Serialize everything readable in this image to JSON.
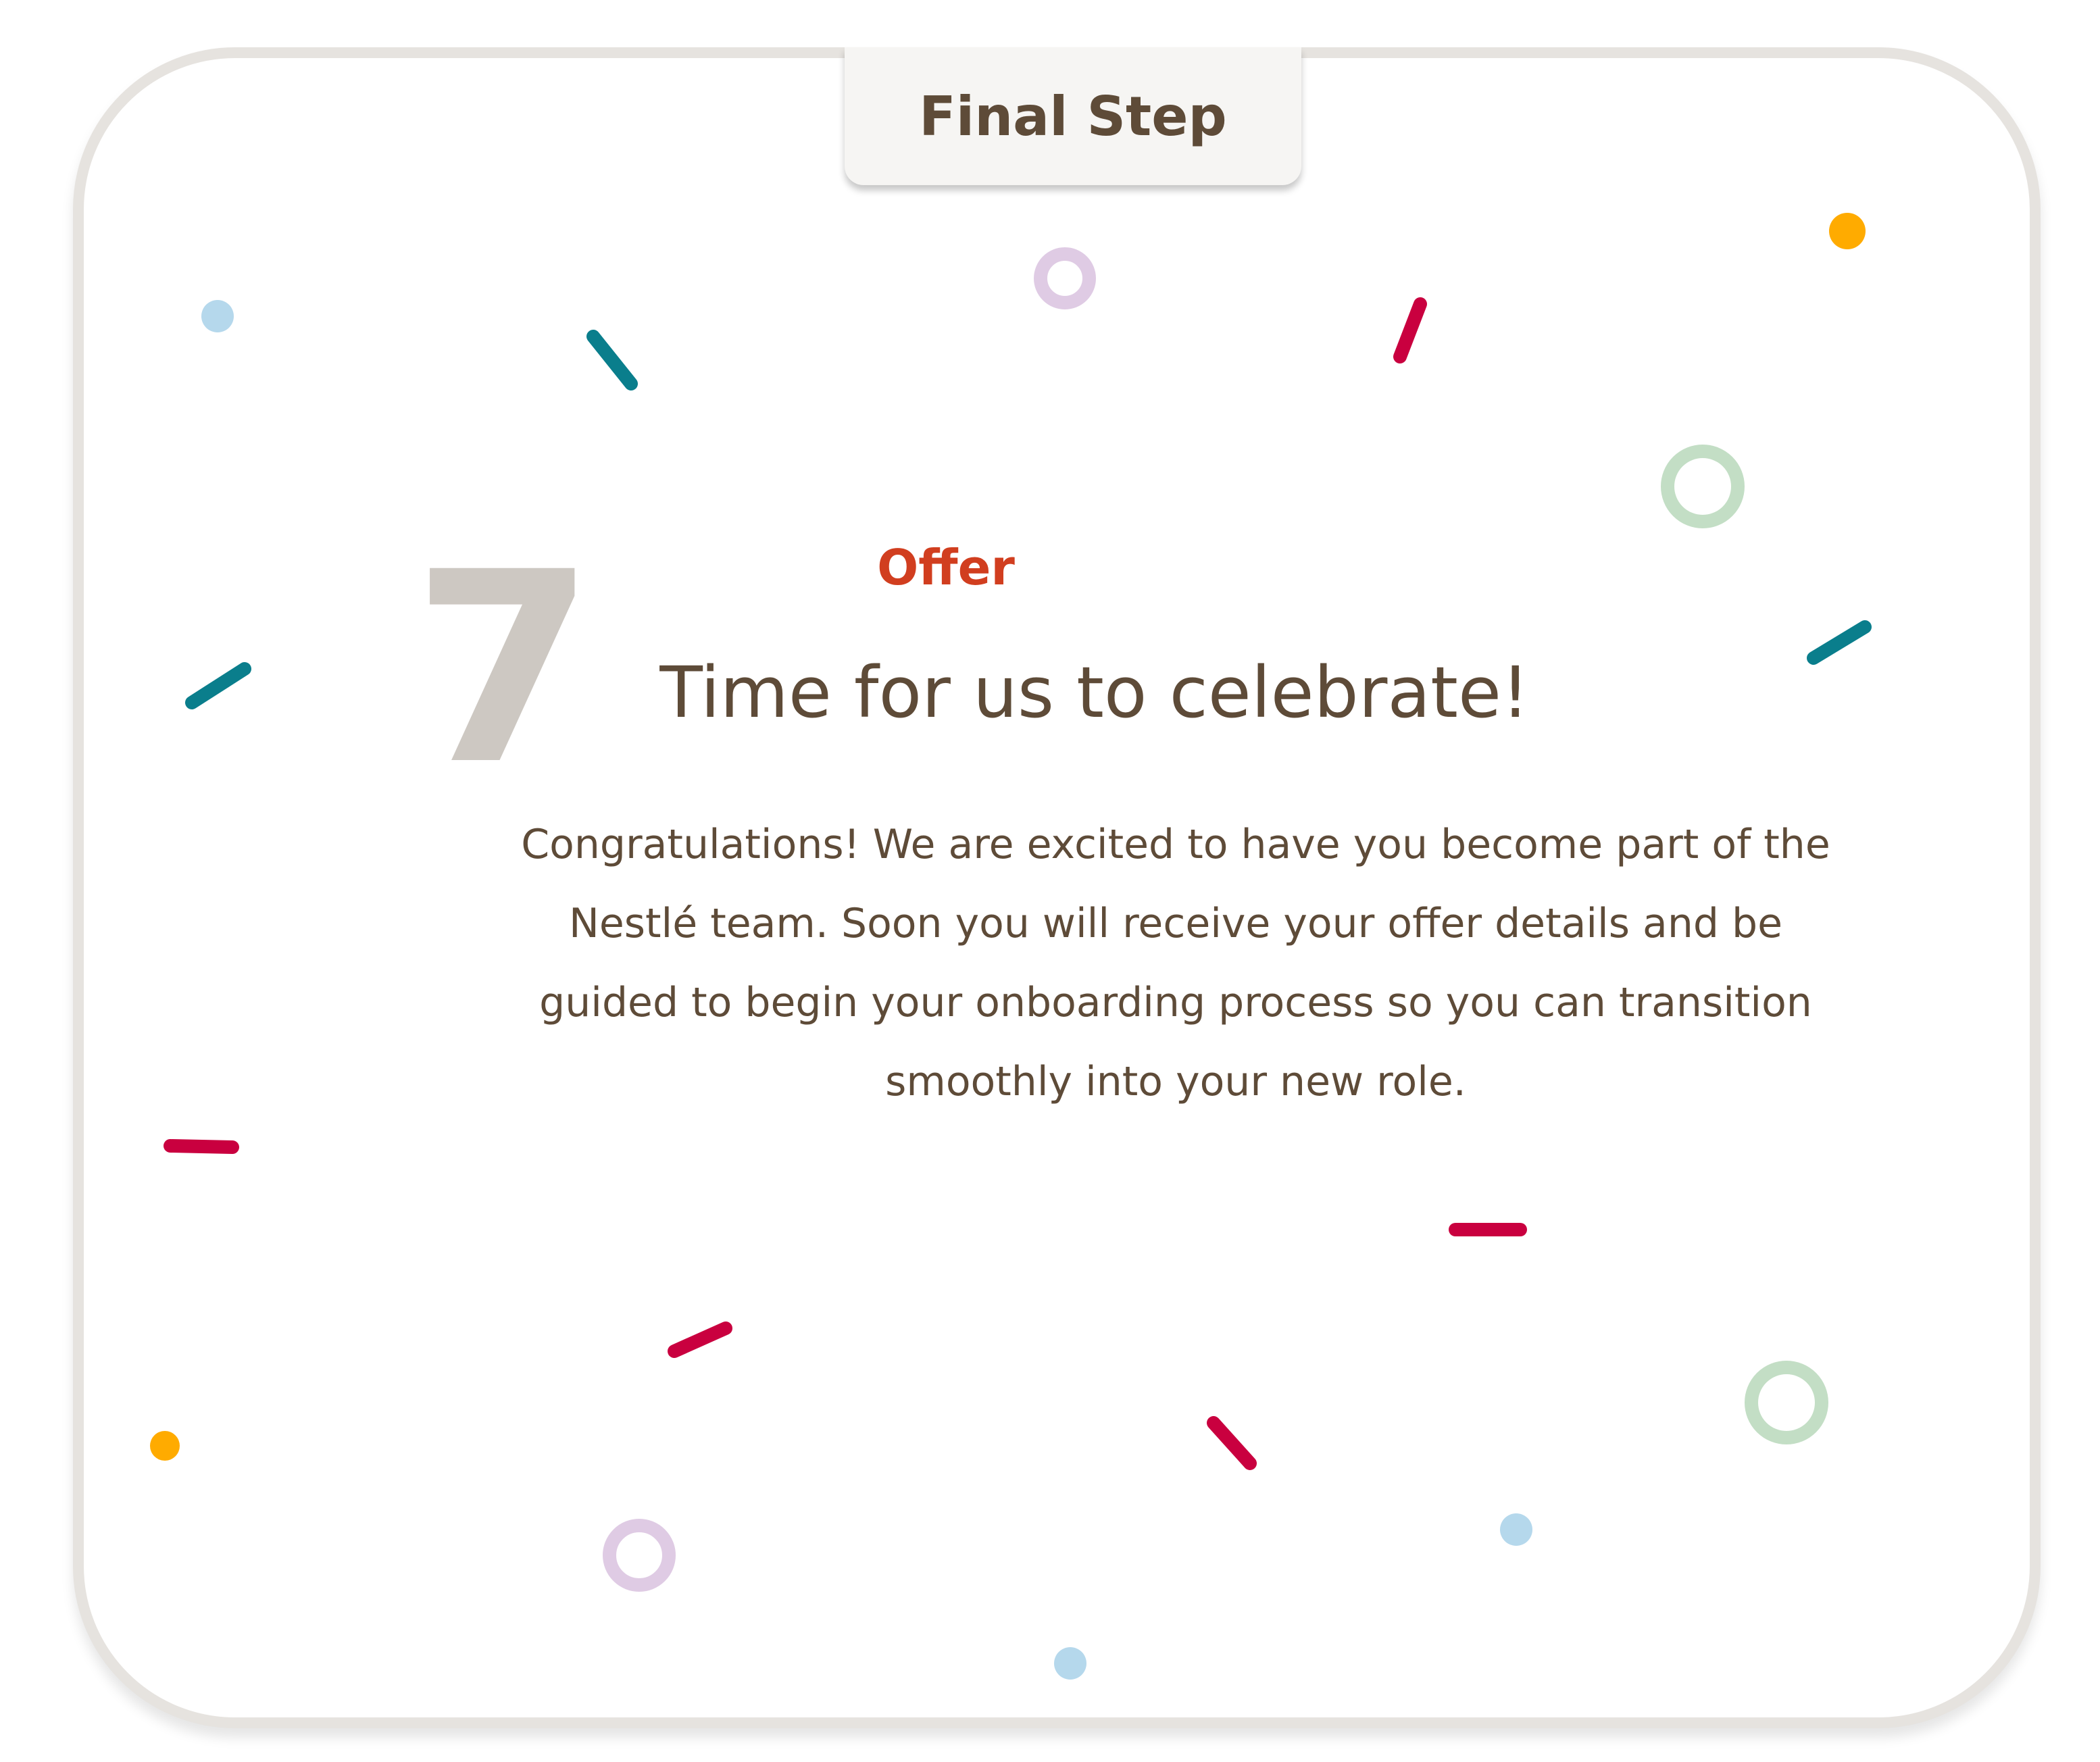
{
  "step_tab": {
    "label": "Final Step"
  },
  "stage": {
    "number": "7",
    "label": "Offer",
    "headline": "Time for us to celebrate!",
    "body": "Congratulations! We are excited to have you become part of the Nestlé team. Soon you will receive your offer details and be guided to begin your onboarding process so you can transition smoothly into your new role."
  },
  "colors": {
    "text_brown": "#5e4b38",
    "accent_red_orange": "#d13e1f",
    "number_gray": "#cdc8c2",
    "card_border": "#e6e3df",
    "confetti_teal": "#0a7e8c",
    "confetti_crimson": "#c9003f",
    "confetti_orange": "#ffab00",
    "confetti_light_blue": "#b5d8ec",
    "confetti_lavender": "#dfcbe4",
    "confetti_mint": "#c3dec5"
  }
}
